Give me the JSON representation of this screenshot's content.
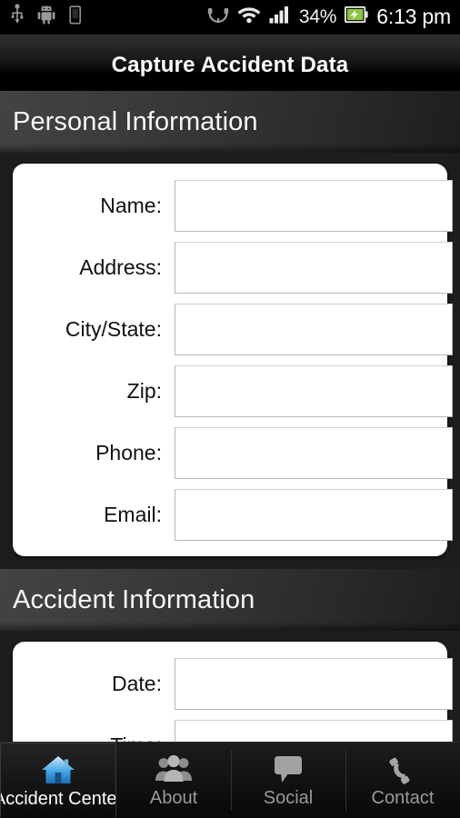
{
  "status_bar": {
    "left_icons": [
      "usb-icon",
      "android-robot-icon",
      "sdcard-icon"
    ],
    "right_icons": [
      "headset-icon",
      "wifi-icon",
      "signal-icon",
      "battery-charging-icon"
    ],
    "battery_percent": "34%",
    "clock": "6:13 pm"
  },
  "title_bar": {
    "title": "Capture Accident Data"
  },
  "sections": [
    {
      "heading": "Personal Information",
      "fields": [
        {
          "label": "Name:",
          "value": "",
          "placeholder": ""
        },
        {
          "label": "Address:",
          "value": "",
          "placeholder": ""
        },
        {
          "label": "City/State:",
          "value": "",
          "placeholder": ""
        },
        {
          "label": "Zip:",
          "value": "",
          "placeholder": ""
        },
        {
          "label": "Phone:",
          "value": "",
          "placeholder": ""
        },
        {
          "label": "Email:",
          "value": "",
          "placeholder": ""
        }
      ]
    },
    {
      "heading": "Accident Information",
      "fields": [
        {
          "label": "Date:",
          "value": "",
          "placeholder": ""
        },
        {
          "label": "Time:",
          "value": "",
          "placeholder": ""
        }
      ]
    }
  ],
  "tab_bar": {
    "tabs": [
      {
        "label": "Accident Center",
        "icon": "home-icon",
        "active": true
      },
      {
        "label": "About",
        "icon": "people-icon",
        "active": false
      },
      {
        "label": "Social",
        "icon": "chat-bubble-icon",
        "active": false
      },
      {
        "label": "Contact",
        "icon": "phone-icon",
        "active": false
      }
    ]
  },
  "colors": {
    "accent_blue": "#4aa8e8",
    "battery_green": "#8cc63f",
    "card_background": "#ffffff",
    "page_background": "#1d1d1d",
    "status_bar_background": "#000000"
  }
}
